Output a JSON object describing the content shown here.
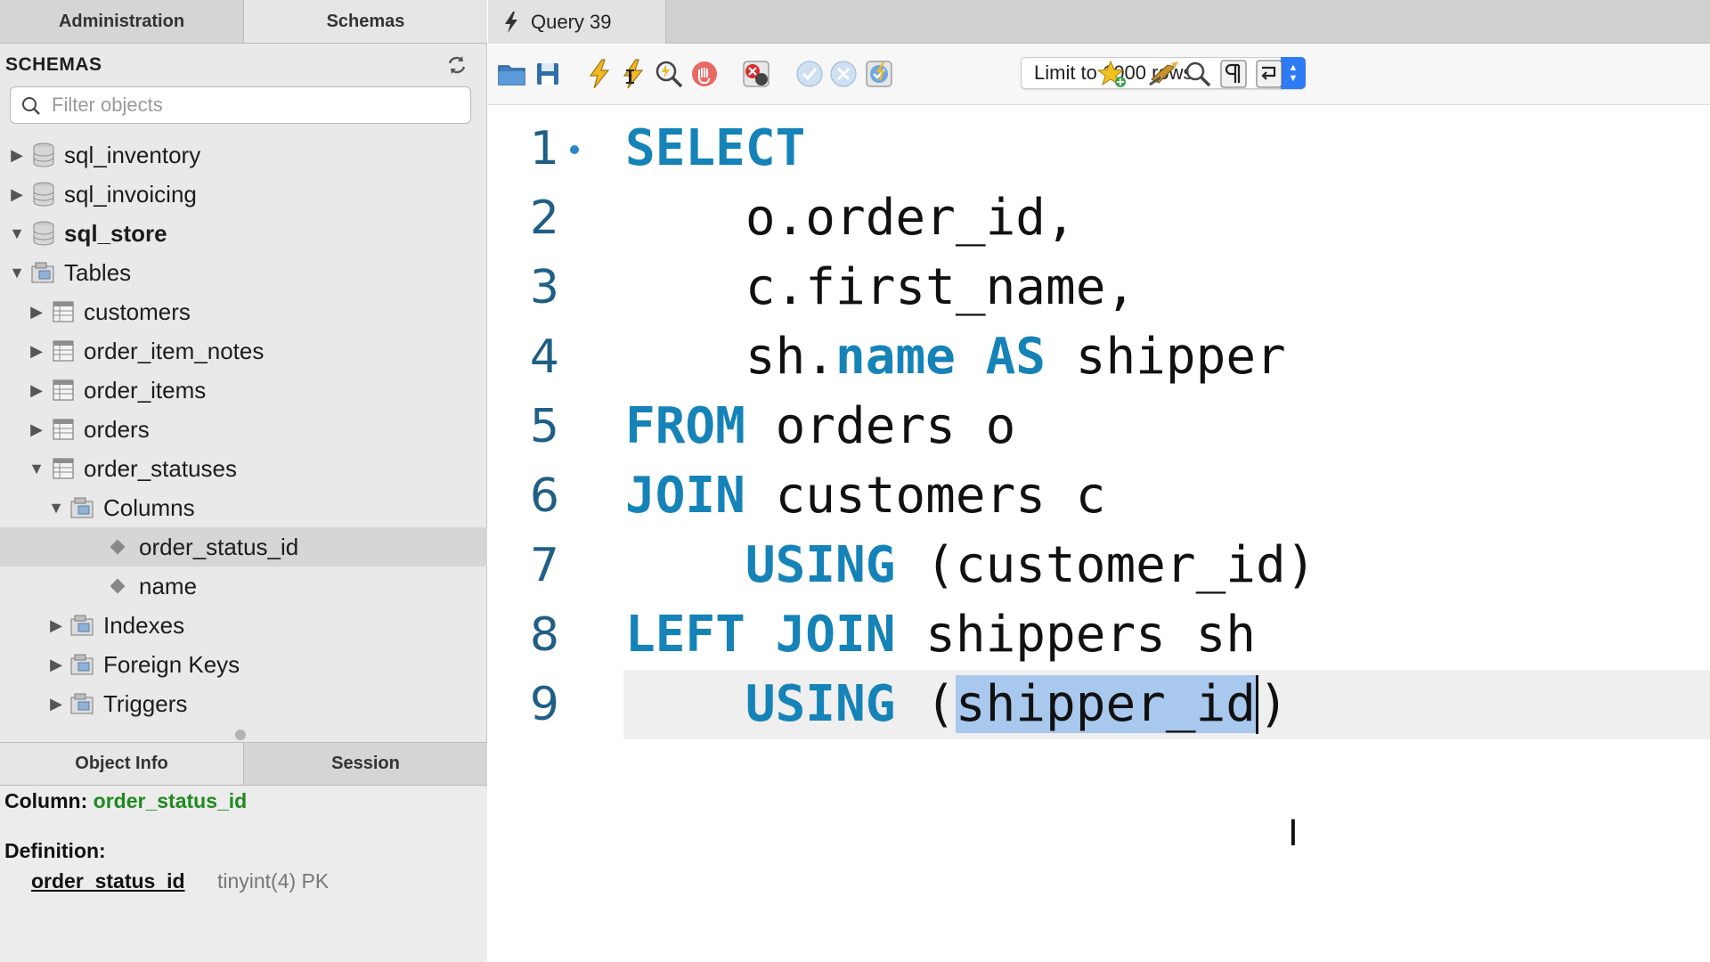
{
  "left_tabs": {
    "administration": "Administration",
    "schemas": "Schemas"
  },
  "schemas": {
    "title": "SCHEMAS",
    "filter_placeholder": "Filter objects",
    "tree": [
      {
        "label": "sql_inventory",
        "level": 0,
        "expanded": false,
        "type": "database",
        "bold": false
      },
      {
        "label": "sql_invoicing",
        "level": 0,
        "expanded": false,
        "type": "database",
        "bold": false
      },
      {
        "label": "sql_store",
        "level": 0,
        "expanded": true,
        "type": "database",
        "bold": true
      },
      {
        "label": "Tables",
        "level": 1,
        "expanded": true,
        "type": "folder"
      },
      {
        "label": "customers",
        "level": 2,
        "expanded": false,
        "type": "table"
      },
      {
        "label": "order_item_notes",
        "level": 2,
        "expanded": false,
        "type": "table"
      },
      {
        "label": "order_items",
        "level": 2,
        "expanded": false,
        "type": "table"
      },
      {
        "label": "orders",
        "level": 2,
        "expanded": false,
        "type": "table"
      },
      {
        "label": "order_statuses",
        "level": 2,
        "expanded": true,
        "type": "table"
      },
      {
        "label": "Columns",
        "level": 3,
        "expanded": true,
        "type": "folder"
      },
      {
        "label": "order_status_id",
        "level": 4,
        "type": "column",
        "selected": true
      },
      {
        "label": "name",
        "level": 4,
        "type": "column"
      },
      {
        "label": "Indexes",
        "level": 3,
        "expanded": false,
        "type": "folder"
      },
      {
        "label": "Foreign Keys",
        "level": 3,
        "expanded": false,
        "type": "folder"
      },
      {
        "label": "Triggers",
        "level": 3,
        "expanded": false,
        "type": "folder"
      }
    ]
  },
  "bottom_tabs": {
    "object_info": "Object Info",
    "session": "Session"
  },
  "object_info": {
    "column_label": "Column:",
    "column_value": "order_status_id",
    "definition_label": "Definition:",
    "def_name": "order_status_id",
    "def_type": "tinyint(4) PK"
  },
  "query_tab": {
    "title": "Query 39"
  },
  "toolbar": {
    "limit_label": "Limit to 1000 rows",
    "buttons": [
      "open-file",
      "save",
      "execute",
      "execute-current",
      "explain",
      "stop",
      "toggle-error-stop",
      "commit",
      "rollback",
      "autocommit",
      "bookmark",
      "beautify",
      "find",
      "invisibles",
      "wrap"
    ]
  },
  "editor": {
    "line_numbers": [
      "1",
      "2",
      "3",
      "4",
      "5",
      "6",
      "7",
      "8",
      "9"
    ],
    "lines": [
      [
        {
          "t": "SELECT",
          "k": true
        }
      ],
      [
        {
          "t": "    o.order_id,",
          "k": false
        }
      ],
      [
        {
          "t": "    c.first_name,",
          "k": false
        }
      ],
      [
        {
          "t": "    sh.",
          "k": false
        },
        {
          "t": "name",
          "k": true
        },
        {
          "t": " ",
          "k": false
        },
        {
          "t": "AS",
          "k": true
        },
        {
          "t": " shipper",
          "k": false
        }
      ],
      [
        {
          "t": "FROM",
          "k": true
        },
        {
          "t": " orders o",
          "k": false
        }
      ],
      [
        {
          "t": "JOIN",
          "k": true
        },
        {
          "t": " customers c",
          "k": false
        }
      ],
      [
        {
          "t": "    ",
          "k": false
        },
        {
          "t": "USING",
          "k": true
        },
        {
          "t": " (customer_id)",
          "k": false
        }
      ],
      [
        {
          "t": "LEFT JOIN",
          "k": true
        },
        {
          "t": " shippers sh",
          "k": false
        }
      ],
      [
        {
          "t": "    ",
          "k": false
        },
        {
          "t": "USING",
          "k": true
        },
        {
          "t": " (",
          "k": false
        },
        {
          "t": "shipper_id",
          "k": false,
          "sel": true
        },
        {
          "t": "|",
          "caret": true
        },
        {
          "t": ")",
          "k": false
        }
      ]
    ],
    "current_line": 9
  },
  "colors": {
    "keyword": "#1583b8",
    "line_number": "#1f5f86",
    "selection": "#a8c8ee",
    "object_info_green": "#1f8a1f",
    "limit_stepper": "#2d7cf6"
  }
}
